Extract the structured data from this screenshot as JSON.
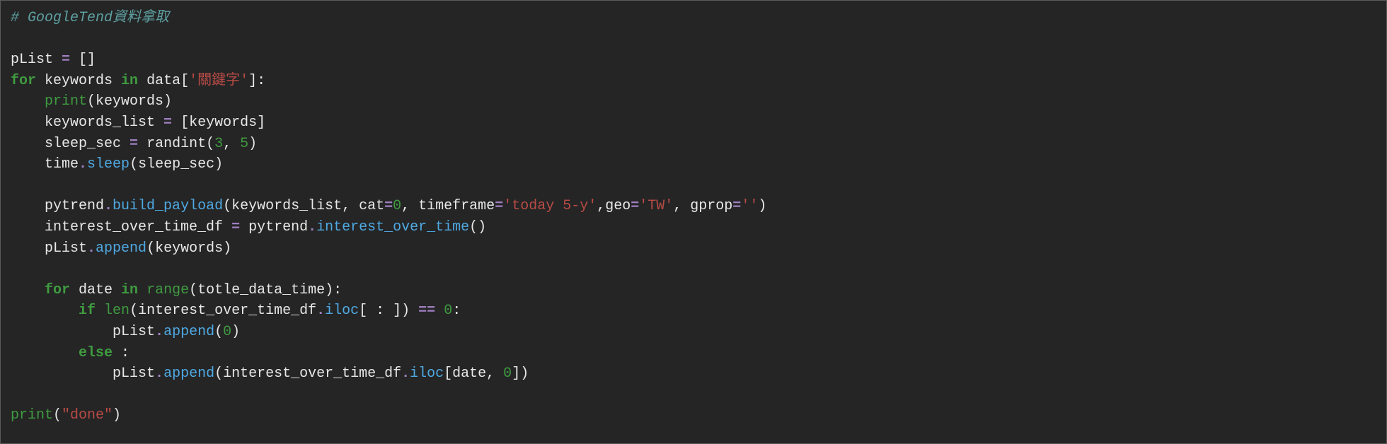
{
  "code": {
    "indent": "    ",
    "lines": [
      {
        "indent": 0,
        "tokens": [
          {
            "cls": "tok-comment",
            "text": "# GoogleTend資料拿取"
          }
        ]
      },
      {
        "indent": 0,
        "tokens": []
      },
      {
        "indent": 0,
        "tokens": [
          {
            "cls": "tok-default",
            "text": "pList "
          },
          {
            "cls": "tok-op",
            "text": "="
          },
          {
            "cls": "tok-default",
            "text": " []"
          }
        ]
      },
      {
        "indent": 0,
        "tokens": [
          {
            "cls": "tok-keyword",
            "text": "for"
          },
          {
            "cls": "tok-default",
            "text": " keywords "
          },
          {
            "cls": "tok-keyword",
            "text": "in"
          },
          {
            "cls": "tok-default",
            "text": " data["
          },
          {
            "cls": "tok-string",
            "text": "'關鍵字'"
          },
          {
            "cls": "tok-default",
            "text": "]:"
          }
        ]
      },
      {
        "indent": 1,
        "tokens": [
          {
            "cls": "tok-builtin",
            "text": "print"
          },
          {
            "cls": "tok-default",
            "text": "(keywords)"
          }
        ]
      },
      {
        "indent": 1,
        "tokens": [
          {
            "cls": "tok-default",
            "text": "keywords_list "
          },
          {
            "cls": "tok-op",
            "text": "="
          },
          {
            "cls": "tok-default",
            "text": " [keywords]"
          }
        ]
      },
      {
        "indent": 1,
        "tokens": [
          {
            "cls": "tok-default",
            "text": "sleep_sec "
          },
          {
            "cls": "tok-op",
            "text": "="
          },
          {
            "cls": "tok-default",
            "text": " randint("
          },
          {
            "cls": "tok-number",
            "text": "3"
          },
          {
            "cls": "tok-default",
            "text": ", "
          },
          {
            "cls": "tok-number",
            "text": "5"
          },
          {
            "cls": "tok-default",
            "text": ")"
          }
        ]
      },
      {
        "indent": 1,
        "tokens": [
          {
            "cls": "tok-default",
            "text": "time"
          },
          {
            "cls": "tok-op",
            "text": "."
          },
          {
            "cls": "tok-func",
            "text": "sleep"
          },
          {
            "cls": "tok-default",
            "text": "(sleep_sec)"
          }
        ]
      },
      {
        "indent": 0,
        "tokens": []
      },
      {
        "indent": 1,
        "tokens": [
          {
            "cls": "tok-default",
            "text": "pytrend"
          },
          {
            "cls": "tok-op",
            "text": "."
          },
          {
            "cls": "tok-func",
            "text": "build_payload"
          },
          {
            "cls": "tok-default",
            "text": "(keywords_list, cat"
          },
          {
            "cls": "tok-op",
            "text": "="
          },
          {
            "cls": "tok-number",
            "text": "0"
          },
          {
            "cls": "tok-default",
            "text": ", timeframe"
          },
          {
            "cls": "tok-op",
            "text": "="
          },
          {
            "cls": "tok-string",
            "text": "'today 5-y'"
          },
          {
            "cls": "tok-default",
            "text": ",geo"
          },
          {
            "cls": "tok-op",
            "text": "="
          },
          {
            "cls": "tok-string",
            "text": "'TW'"
          },
          {
            "cls": "tok-default",
            "text": ", gprop"
          },
          {
            "cls": "tok-op",
            "text": "="
          },
          {
            "cls": "tok-string",
            "text": "''"
          },
          {
            "cls": "tok-default",
            "text": ")"
          }
        ]
      },
      {
        "indent": 1,
        "tokens": [
          {
            "cls": "tok-default",
            "text": "interest_over_time_df "
          },
          {
            "cls": "tok-op",
            "text": "="
          },
          {
            "cls": "tok-default",
            "text": " pytrend"
          },
          {
            "cls": "tok-op",
            "text": "."
          },
          {
            "cls": "tok-func",
            "text": "interest_over_time"
          },
          {
            "cls": "tok-default",
            "text": "()"
          }
        ]
      },
      {
        "indent": 1,
        "tokens": [
          {
            "cls": "tok-default",
            "text": "pList"
          },
          {
            "cls": "tok-op",
            "text": "."
          },
          {
            "cls": "tok-func",
            "text": "append"
          },
          {
            "cls": "tok-default",
            "text": "(keywords)"
          }
        ]
      },
      {
        "indent": 0,
        "tokens": []
      },
      {
        "indent": 1,
        "tokens": [
          {
            "cls": "tok-keyword",
            "text": "for"
          },
          {
            "cls": "tok-default",
            "text": " date "
          },
          {
            "cls": "tok-keyword",
            "text": "in"
          },
          {
            "cls": "tok-default",
            "text": " "
          },
          {
            "cls": "tok-builtin",
            "text": "range"
          },
          {
            "cls": "tok-default",
            "text": "(totle_data_time):"
          }
        ]
      },
      {
        "indent": 2,
        "tokens": [
          {
            "cls": "tok-keyword",
            "text": "if"
          },
          {
            "cls": "tok-default",
            "text": " "
          },
          {
            "cls": "tok-builtin",
            "text": "len"
          },
          {
            "cls": "tok-default",
            "text": "(interest_over_time_df"
          },
          {
            "cls": "tok-op",
            "text": "."
          },
          {
            "cls": "tok-func",
            "text": "iloc"
          },
          {
            "cls": "tok-default",
            "text": "[ : ]) "
          },
          {
            "cls": "tok-op",
            "text": "=="
          },
          {
            "cls": "tok-default",
            "text": " "
          },
          {
            "cls": "tok-number",
            "text": "0"
          },
          {
            "cls": "tok-default",
            "text": ":"
          }
        ]
      },
      {
        "indent": 3,
        "tokens": [
          {
            "cls": "tok-default",
            "text": "pList"
          },
          {
            "cls": "tok-op",
            "text": "."
          },
          {
            "cls": "tok-func",
            "text": "append"
          },
          {
            "cls": "tok-default",
            "text": "("
          },
          {
            "cls": "tok-number",
            "text": "0"
          },
          {
            "cls": "tok-default",
            "text": ")"
          }
        ]
      },
      {
        "indent": 2,
        "tokens": [
          {
            "cls": "tok-keyword",
            "text": "else"
          },
          {
            "cls": "tok-default",
            "text": " :"
          }
        ]
      },
      {
        "indent": 3,
        "tokens": [
          {
            "cls": "tok-default",
            "text": "pList"
          },
          {
            "cls": "tok-op",
            "text": "."
          },
          {
            "cls": "tok-func",
            "text": "append"
          },
          {
            "cls": "tok-default",
            "text": "(interest_over_time_df"
          },
          {
            "cls": "tok-op",
            "text": "."
          },
          {
            "cls": "tok-func",
            "text": "iloc"
          },
          {
            "cls": "tok-default",
            "text": "[date, "
          },
          {
            "cls": "tok-number",
            "text": "0"
          },
          {
            "cls": "tok-default",
            "text": "])"
          }
        ]
      },
      {
        "indent": 0,
        "tokens": []
      },
      {
        "indent": 0,
        "tokens": [
          {
            "cls": "tok-builtin",
            "text": "print"
          },
          {
            "cls": "tok-default",
            "text": "("
          },
          {
            "cls": "tok-string",
            "text": "\"done\""
          },
          {
            "cls": "tok-default",
            "text": ")"
          }
        ]
      }
    ]
  }
}
